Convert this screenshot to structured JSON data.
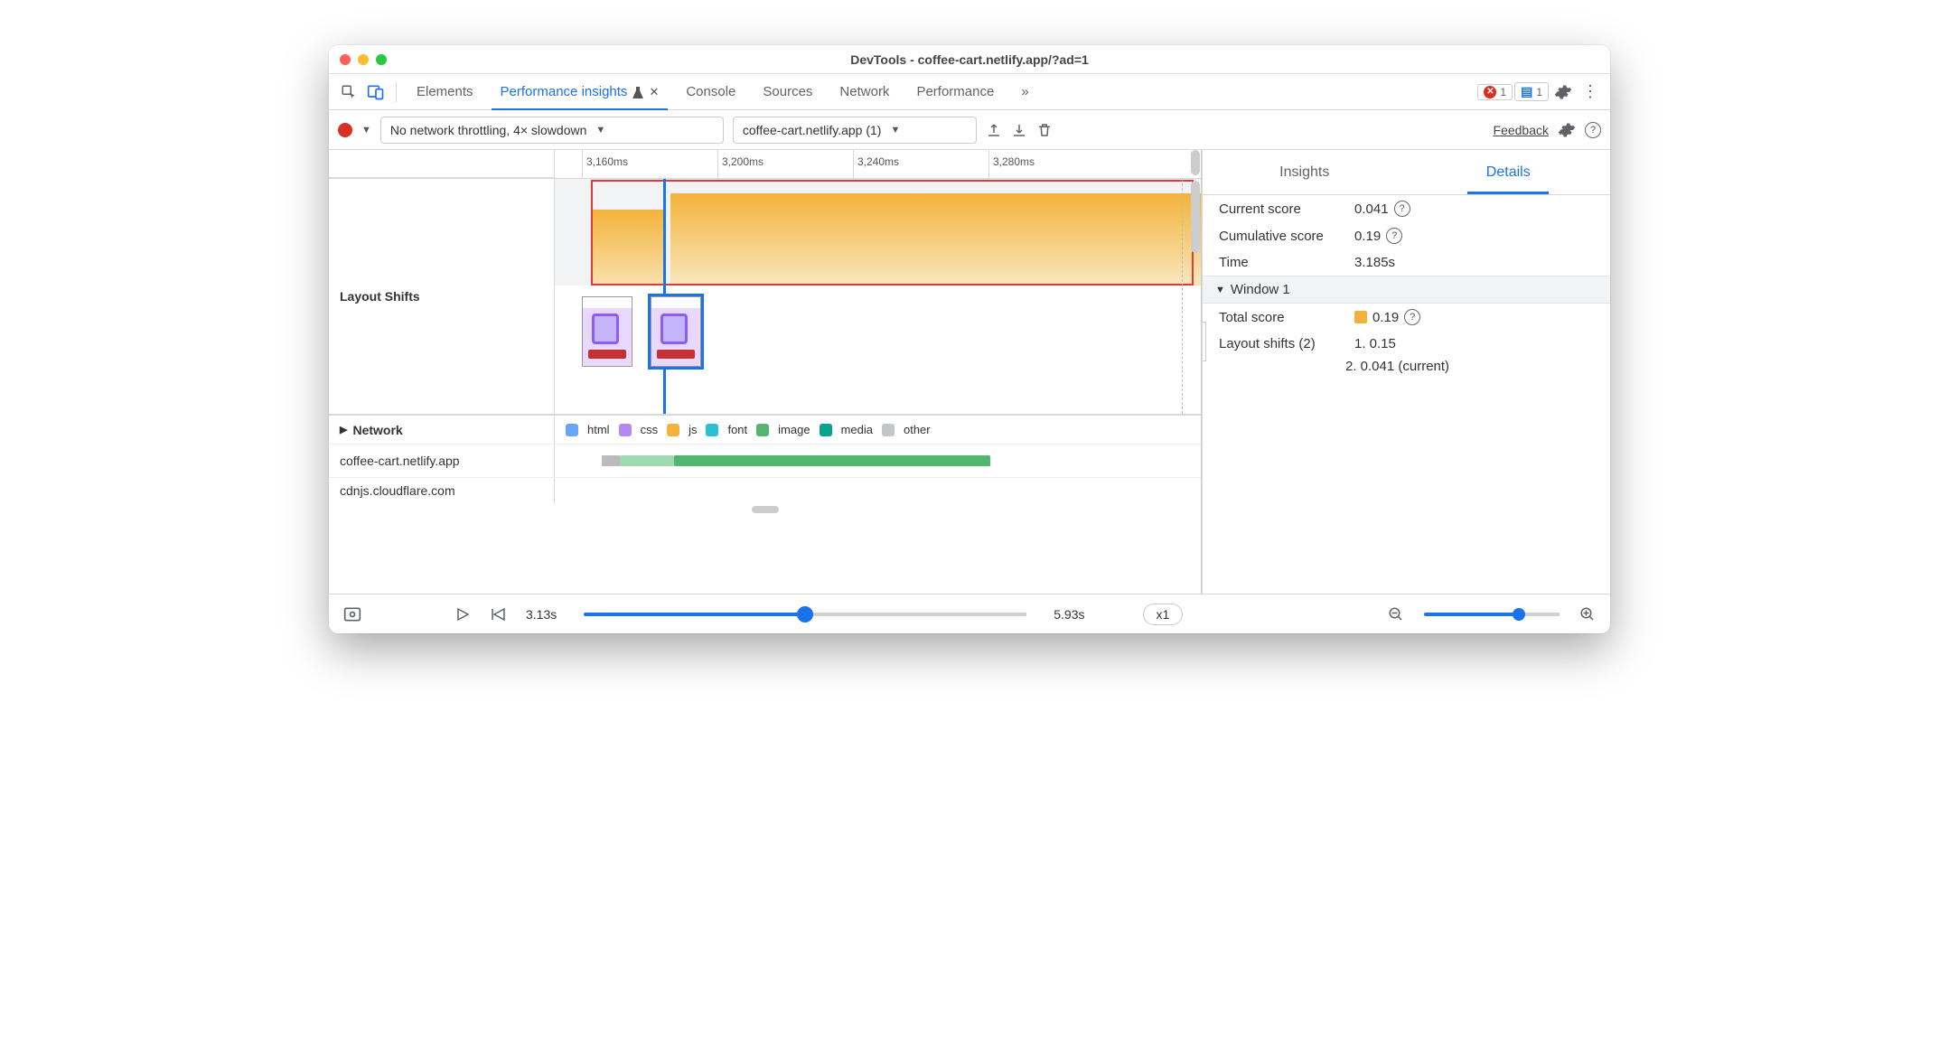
{
  "window": {
    "title": "DevTools - coffee-cart.netlify.app/?ad=1"
  },
  "tabs": {
    "elements": "Elements",
    "perf_insights": "Performance insights",
    "console": "Console",
    "sources": "Sources",
    "network": "Network",
    "performance": "Performance",
    "overflow": "»",
    "err_count": "1",
    "info_count": "1"
  },
  "toolbar": {
    "throttling": "No network throttling, 4× slowdown",
    "recording": "coffee-cart.netlify.app (1)",
    "feedback": "Feedback"
  },
  "ruler": [
    "3,160ms",
    "3,200ms",
    "3,240ms",
    "3,280ms"
  ],
  "layout_shifts_label": "Layout Shifts",
  "network": {
    "label": "Network",
    "hosts": [
      "coffee-cart.netlify.app",
      "cdnjs.cloudflare.com"
    ],
    "legend": {
      "html": "html",
      "css": "css",
      "js": "js",
      "font": "font",
      "image": "image",
      "media": "media",
      "other": "other"
    }
  },
  "right": {
    "tabs": {
      "insights": "Insights",
      "details": "Details"
    },
    "current_score_k": "Current score",
    "current_score_v": "0.041",
    "cum_score_k": "Cumulative score",
    "cum_score_v": "0.19",
    "time_k": "Time",
    "time_v": "3.185s",
    "window_hdr": "Window 1",
    "total_score_k": "Total score",
    "total_score_v": "0.19",
    "ls_k": "Layout shifts (2)",
    "ls_1": "1. 0.15",
    "ls_2": "2. 0.041 (current)"
  },
  "footer": {
    "start": "3.13s",
    "end": "5.93s",
    "speed": "x1"
  },
  "colors": {
    "html": "#6aa4f8",
    "css": "#b388f5",
    "js": "#f3b33a",
    "font": "#29c0d4",
    "image": "#53b66e",
    "media": "#0aa18f",
    "other": "#c1c6c9"
  }
}
